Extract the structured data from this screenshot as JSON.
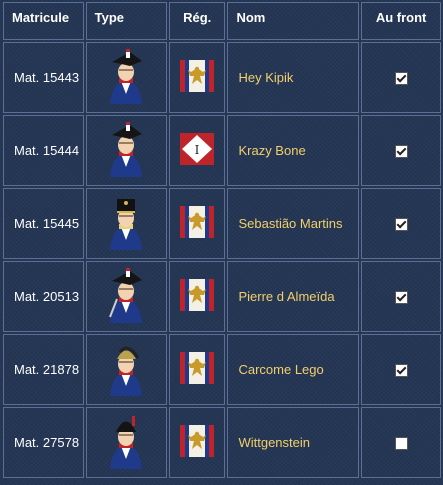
{
  "headers": {
    "matricule": "Matricule",
    "type": "Type",
    "regiment": "Rég.",
    "nom": "Nom",
    "au_front": "Au front"
  },
  "colors": {
    "background": "#243654",
    "cell_border": "#5a6f93",
    "name_link": "#f2cf6a"
  },
  "rows": [
    {
      "matricule": "Mat. 15443",
      "type_icon": "bicorne-grenadier-portrait-icon",
      "regiment_icon": "eagle-flag-icon",
      "nom": "Hey Kipik",
      "au_front": true
    },
    {
      "matricule": "Mat. 15444",
      "type_icon": "bicorne-grenadier-portrait-icon",
      "regiment_icon": "diamond-flag-icon",
      "regiment_text": "I",
      "nom": "Krazy Bone",
      "au_front": true
    },
    {
      "matricule": "Mat. 15445",
      "type_icon": "shako-soldier-portrait-icon",
      "regiment_icon": "eagle-flag-icon",
      "nom": "Sebastião Martins",
      "au_front": true
    },
    {
      "matricule": "Mat. 20513",
      "type_icon": "bicorne-officer-portrait-icon",
      "regiment_icon": "eagle-flag-icon",
      "nom": "Pierre d Almeïda",
      "au_front": true
    },
    {
      "matricule": "Mat. 21878",
      "type_icon": "helmet-dragoon-portrait-icon",
      "regiment_icon": "eagle-flag-icon",
      "nom": "Carcome Lego",
      "au_front": true
    },
    {
      "matricule": "Mat. 27578",
      "type_icon": "bearskin-grenadier-portrait-icon",
      "regiment_icon": "eagle-flag-icon",
      "nom": "Wittgenstein",
      "au_front": false
    }
  ]
}
